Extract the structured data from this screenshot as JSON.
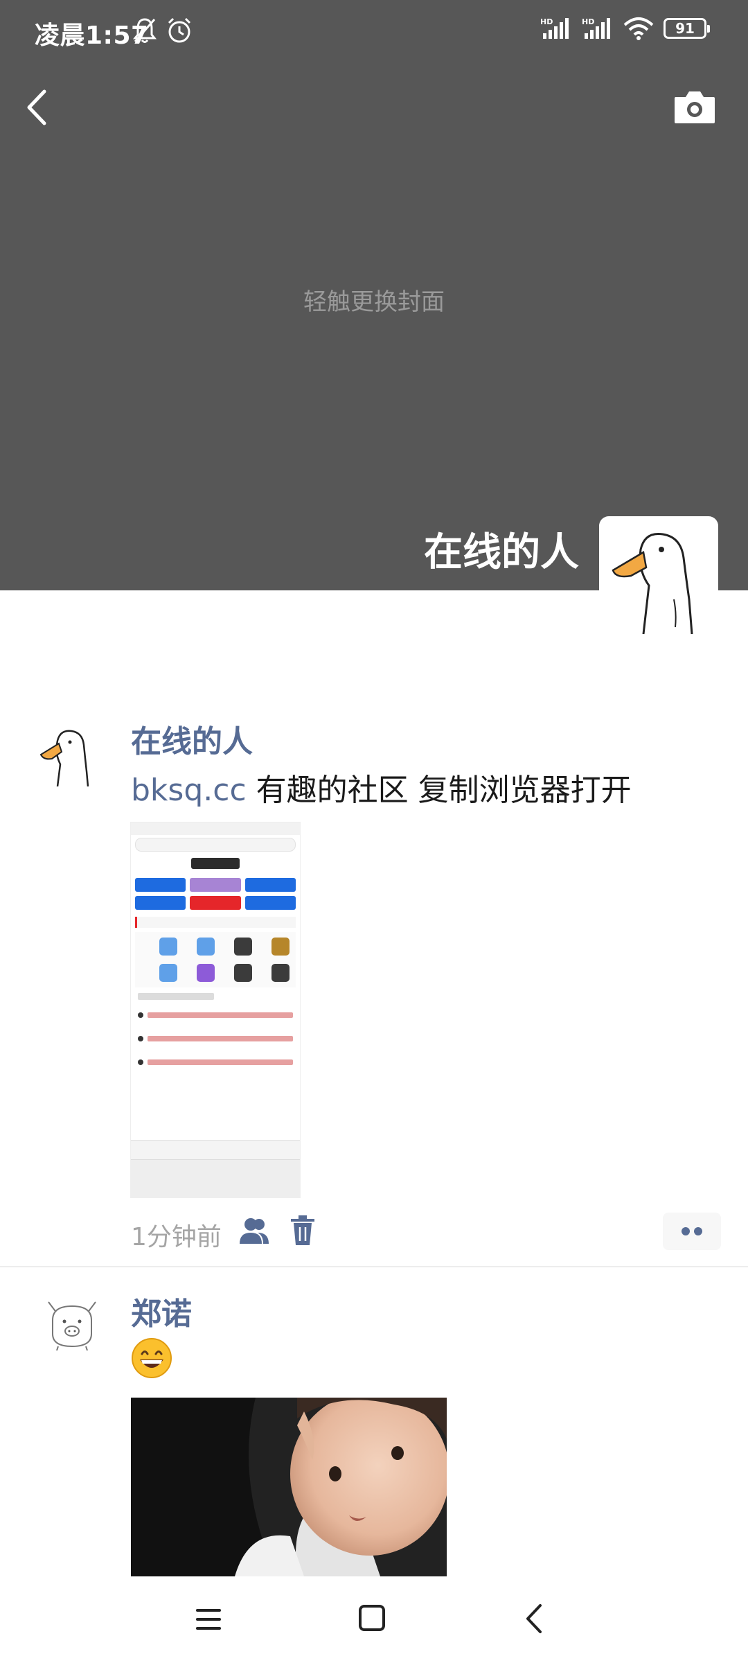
{
  "status_bar": {
    "time": "凌晨1:57",
    "battery": "91",
    "left_icons": [
      "bell-off-icon",
      "alarm-icon"
    ],
    "right_icons": [
      "hd-signal-icon",
      "hd-signal-icon",
      "wifi-icon",
      "battery-icon"
    ]
  },
  "header": {
    "back_icon": "chevron-left-icon",
    "camera_icon": "camera-icon"
  },
  "cover": {
    "hint": "轻触更换封面",
    "username": "在线的人"
  },
  "posts": [
    {
      "author": "在线的人",
      "text_link": "bksq.cc",
      "text_body": " 有趣的社区 复制浏览器打开",
      "time": "1分钟前",
      "icons": [
        "friends-visibility-icon",
        "trash-icon",
        "more-icon"
      ]
    },
    {
      "author": "郑诺",
      "emoji": "grinning-face-emoji"
    }
  ],
  "colors": {
    "cover_bg": "#575757",
    "name_blue": "#566b94",
    "text": "#1a1a1a",
    "meta_gray": "#a5a5a5"
  },
  "system_nav": [
    "menu-icon",
    "home-icon",
    "back-icon"
  ]
}
